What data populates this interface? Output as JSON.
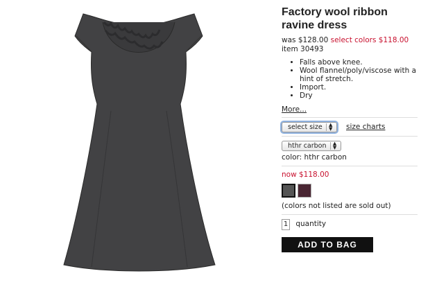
{
  "product": {
    "title": "Factory wool ribbon ravine dress",
    "was_price": "was $128.00",
    "sale_price": "select colors $118.00",
    "item_number": "item 30493",
    "features": [
      "Falls above knee.",
      "Wool flannel/poly/viscose with a hint of stretch.",
      "Import.",
      "Dry"
    ],
    "more_link": "More...",
    "size_select": "select size",
    "size_charts_link": "size charts",
    "color_select": "hthr carbon",
    "color_label": "color: hthr carbon",
    "now_price": "now $118.00",
    "swatch_colors": [
      "#555555",
      "#4a2633"
    ],
    "sold_out_note": "(colors not listed are sold out)",
    "quantity_value": "1",
    "quantity_label": "quantity",
    "add_to_bag": "ADD TO BAG"
  }
}
